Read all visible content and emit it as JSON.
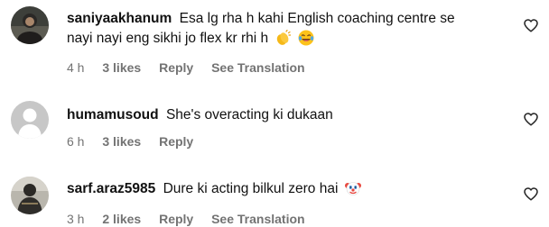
{
  "comments": [
    {
      "username": "saniyaakhanum",
      "text_line1": "Esa lg rha h kahi English coaching centre se",
      "text_line2": "nayi nayi eng sikhi jo flex kr rhi h",
      "emojis": [
        "clapping-hands-icon",
        "laughing-face-icon"
      ],
      "time": "4 h",
      "likes": "3 likes",
      "reply": "Reply",
      "translation": "See Translation"
    },
    {
      "username": "humamusoud",
      "text_line1": "She's overacting ki dukaan",
      "time": "6 h",
      "likes": "3 likes",
      "reply": "Reply"
    },
    {
      "username": "sarf.araz5985",
      "text_line1": "Dure ki acting bilkul zero hai",
      "emojis": [
        "clown-face-icon"
      ],
      "time": "3 h",
      "likes": "2 likes",
      "reply": "Reply",
      "translation": "See Translation"
    }
  ],
  "icons": {
    "like": "heart-outline-icon",
    "default_avatar": "default-avatar-icon"
  },
  "colors": {
    "text": "#111111",
    "secondary": "#737373",
    "default_avatar_bg": "#c7c7c7"
  }
}
